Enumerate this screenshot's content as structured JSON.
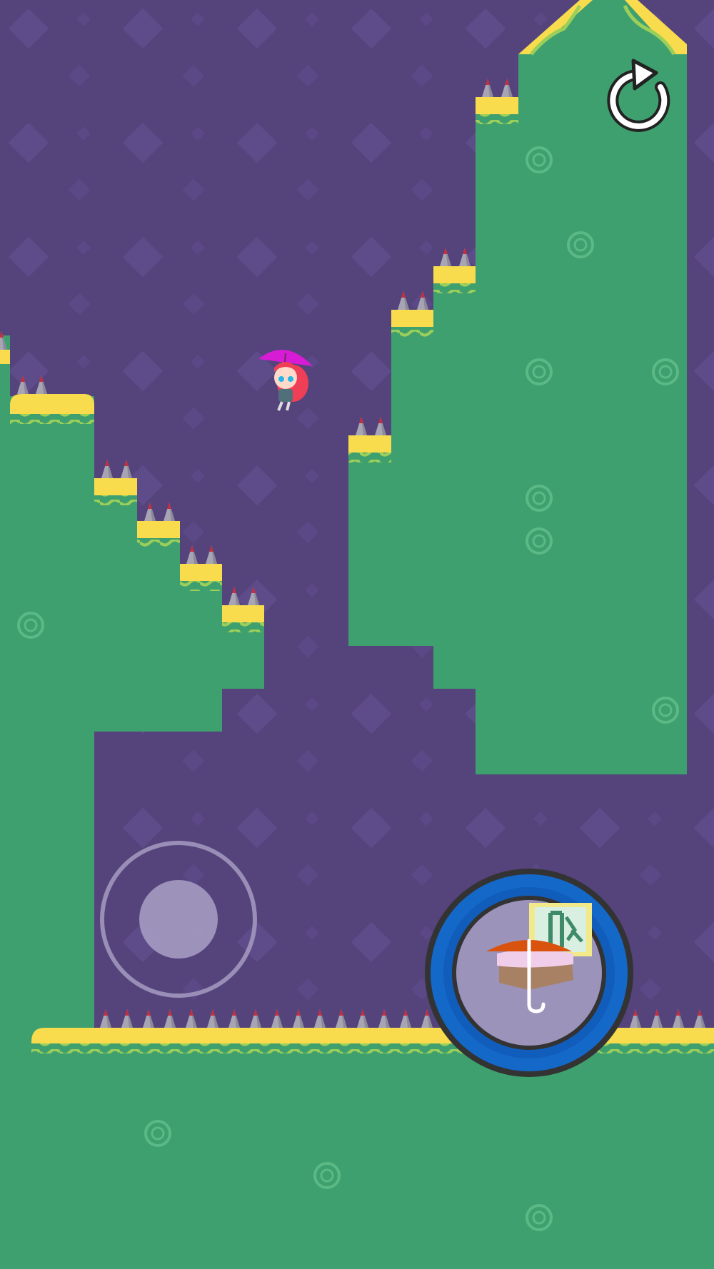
{
  "game": {
    "palette": {
      "sky": "#55437c",
      "sky_tile": "#5e4b8a",
      "terrain": "#3fa06f",
      "terrain_ring": "#5bb985",
      "top_yellow": "#f9dc4d",
      "top_green_wave": "#9ccf5a",
      "spike_body": "#a7a4b3",
      "spike_tip": "#c2303f",
      "button_ring": "#1468c8",
      "button_border": "#333333",
      "umbrella_canopy": "#d9530f",
      "character_hair": "#ef3f57",
      "character_umbrella": "#d81bd4"
    },
    "restart_button": {
      "icon": "restart-icon"
    },
    "joystick": {
      "icon": "joystick-knob"
    },
    "action_button": {
      "icon": "umbrella-platform-icon",
      "exit_sign_icon": "exit-icon"
    },
    "character": {
      "description_icon": "girl-with-umbrella"
    },
    "hazards": {
      "spike_icon": "spike"
    }
  }
}
